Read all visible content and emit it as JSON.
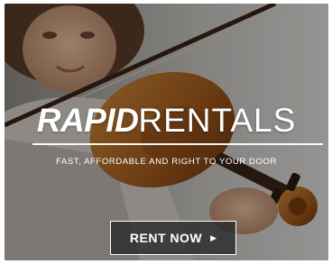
{
  "ad": {
    "brand_bold": "RAPID",
    "brand_regular": "RENTALS",
    "tagline": "FAST, AFFORDABLE AND RIGHT TO YOUR DOOR",
    "cta_label": "RENT NOW",
    "cta_arrow_icon": "chevron-right-icon",
    "cta_arrow_glyph": "▶"
  },
  "colors": {
    "text": "#ffffff",
    "violin": "#b5651d",
    "overlay": "#000000"
  }
}
